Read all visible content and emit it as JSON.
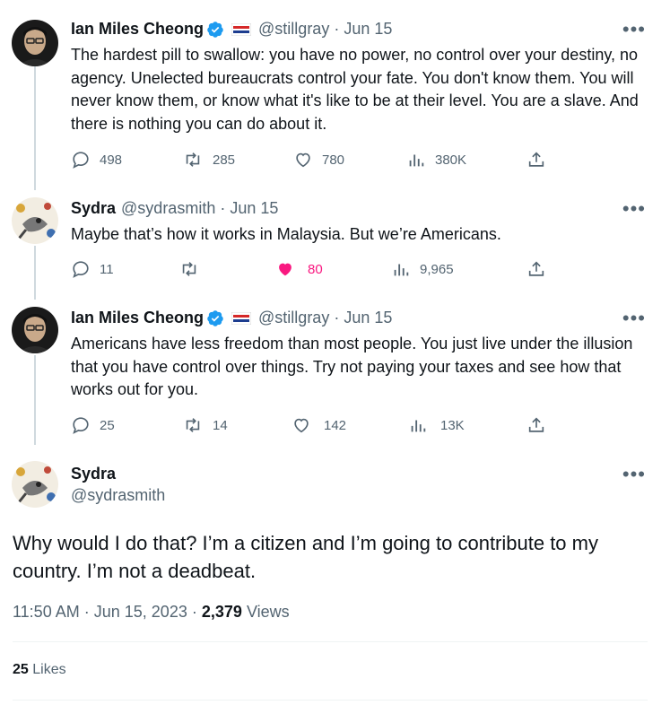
{
  "colors": {
    "text": "#0f1419",
    "secondary": "#536471",
    "verified": "#1d9bf0",
    "like_active": "#f91880",
    "divider": "#eff3f4"
  },
  "tweets": [
    {
      "name": "Ian Miles Cheong",
      "handle": "@stillgray",
      "date": "Jun 15",
      "verified": true,
      "text": "The hardest pill to swallow: you have no power, no control over your destiny, no agency. Unelected bureaucrats control your fate. You don't know them. You will never know them, or know what it's like to be at their level. You are a slave. And there is nothing you can do about it.",
      "replies": "498",
      "retweets": "285",
      "likes": "780",
      "views": "380K",
      "icons": [
        "reply-icon",
        "retweet-icon",
        "like-icon",
        "views-icon",
        "share-icon"
      ]
    },
    {
      "name": "Sydra",
      "handle": "@sydrasmith",
      "date": "Jun 15",
      "text": "Maybe that’s how it works in Malaysia. But we’re Americans.",
      "replies": "11",
      "retweets": "",
      "likes": "80",
      "views": "9,965",
      "liked": true
    },
    {
      "name": "Ian Miles Cheong",
      "handle": "@stillgray",
      "date": "Jun 15",
      "verified": true,
      "text": "Americans have less freedom than most people. You just live under the illusion that you have control over things. Try not paying your taxes and see how that works out for you.",
      "replies": "25",
      "retweets": "14",
      "likes": "142",
      "views": "13K"
    }
  ],
  "focus": {
    "name": "Sydra",
    "handle": "@sydrasmith",
    "text": "Why would I do that? I’m a citizen and I’m going to contribute to my country. I’m not a deadbeat.",
    "time": "11:50 AM",
    "date": "Jun 15, 2023",
    "views_count": "2,379",
    "views_label": "Views",
    "likes_count": "25",
    "likes_label": "Likes"
  },
  "separator": "·",
  "more_label": "•••"
}
